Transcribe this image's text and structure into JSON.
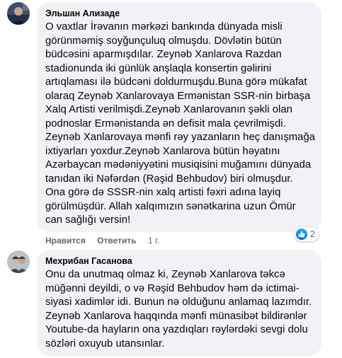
{
  "comments": [
    {
      "author": "Эльшан Ализаде",
      "text_lines": [
        "O vaxtlar İrəvanın mərkəzi bankında dünyada misli",
        "görünməmiş soyğunçuluq olmuşdu. Dövlətin bütün",
        "büdcəsini aparmışdılar. Zeynəb Xanlarova Razdan",
        "stadionunda iki günlük anşlaqla konsertin gəlirini",
        "artıqlaması ilə büdcəni doldurmuşdu.Buna görə mükafat",
        "olaraq Zeynəb Xanlarovaya Ermənistan SSR-nin birbaşa",
        "Xalq Artisti verilmişdi.Zeynəb Xanlarovanın şəkli olan",
        "podnoslar Ermənistanda ən defisit mala çevrilmişdi.",
        "Zeynəb Xanlarovaya mənfi rəy yazanların heç danışmağa",
        "ixtiyarları yoxdur.Zeynəb Xanlarova bütün həyatını",
        "Azərbaycan mədəniyyətini musiqisini muğamını dünyada",
        "tanıdan iki Nəfərdən (Rəşid Behbudov) biri olmuşdur.",
        "Ona görə də SSSR-nin xalq artisti fəxri adına layiq",
        "görülmüşdür. Allah xalqımızın sənətkarina uzun Ömür",
        "can sağlığı versin!"
      ],
      "reaction_count": "2",
      "reaction_icon": "like-icon"
    },
    {
      "author": "Мехрибан Гасанова",
      "actions": [
        "Нравится",
        "Ответить",
        "1 г."
      ],
      "text_lines": [
        "Onu da unutmaq olmaz ki, Zeynəb Xanlarova təkcə",
        "müğənni deyildi, o və Rəşid Behbudov həm də ictimai-",
        "siyasi xadimlər idi. Bunun nə olduğunu anlamaq lazımdır.",
        "Zeynəb Xanlarova haqqında mənfi münasibət bildirənlər",
        "Youtube-da hayların ona yazdıqları rəylərdəki sevgi dolu",
        "sözləri oxuyub utansınlar."
      ]
    }
  ],
  "colors": {
    "bubble_bg": "#f0f2f5",
    "text": "#050505",
    "secondary_text": "#65676b",
    "like_blue": "#1877f2"
  }
}
